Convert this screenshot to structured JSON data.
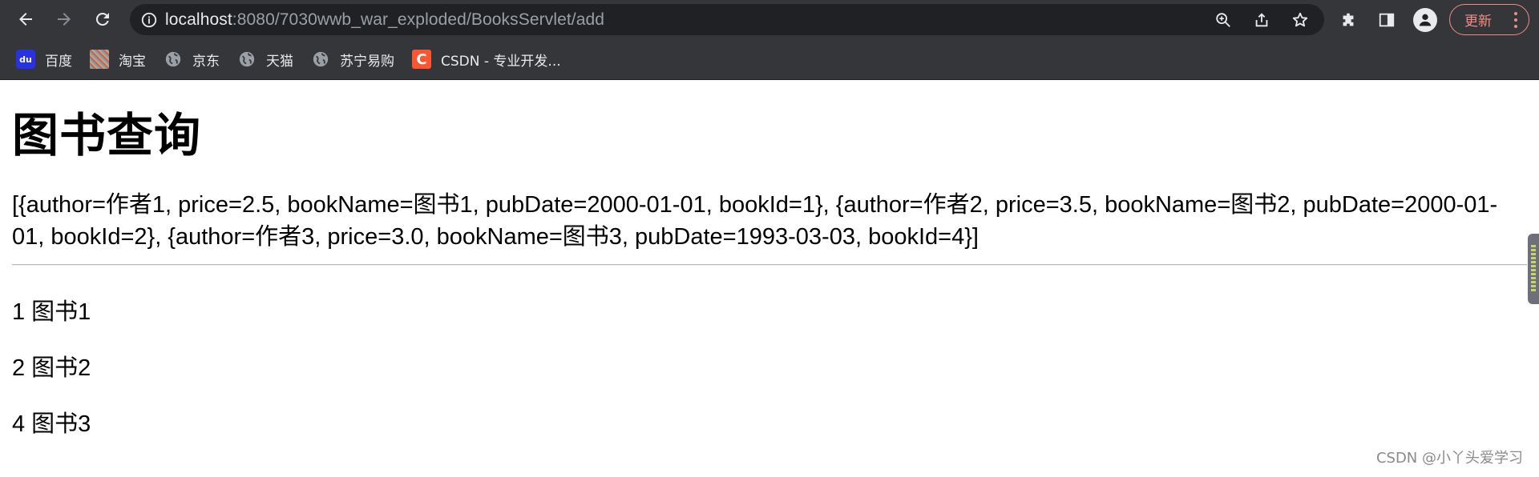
{
  "browser": {
    "url_host": "localhost",
    "url_path": ":8080/7030wwb_war_exploded/BooksServlet/add",
    "update_label": "更新"
  },
  "bookmarks": [
    {
      "label": "百度",
      "icon": "baidu-icon"
    },
    {
      "label": "淘宝",
      "icon": "taobao-icon"
    },
    {
      "label": "京东",
      "icon": "globe-icon"
    },
    {
      "label": "天猫",
      "icon": "globe-icon"
    },
    {
      "label": "苏宁易购",
      "icon": "globe-icon"
    },
    {
      "label": "CSDN - 专业开发...",
      "icon": "csdn-icon"
    }
  ],
  "page": {
    "title": "图书查询",
    "raw_list": "[{author=作者1, price=2.5, bookName=图书1, pubDate=2000-01-01, bookId=1}, {author=作者2, price=3.5, bookName=图书2, pubDate=2000-01-01, bookId=2}, {author=作者3, price=3.0, bookName=图书3, pubDate=1993-03-03, bookId=4}]",
    "books": [
      {
        "text": "1 图书1"
      },
      {
        "text": "2 图书2"
      },
      {
        "text": "4 图书3"
      }
    ]
  },
  "watermark": "CSDN @小丫头爱学习"
}
